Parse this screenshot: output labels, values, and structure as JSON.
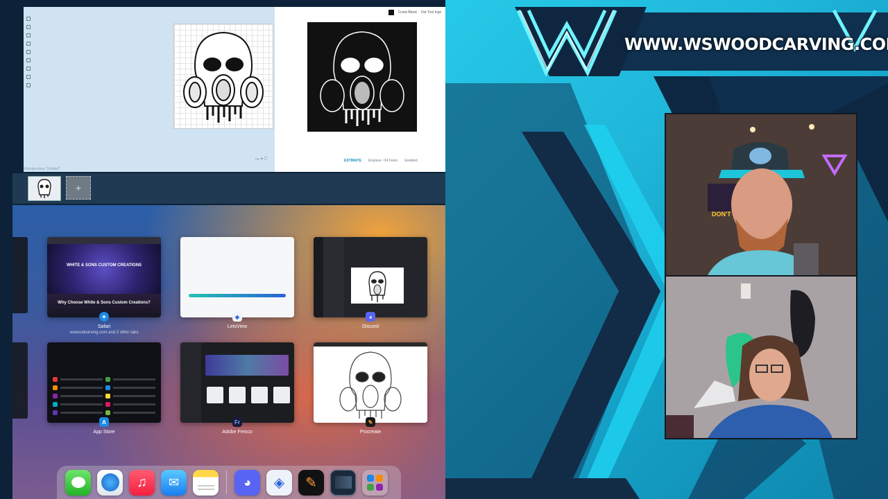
{
  "overlay": {
    "site_url": "WWW.WSWOODCARVING.COM",
    "sign_text": "DON'T TREA"
  },
  "top_app": {
    "window_title": "Woodpeckers  \"Untitled\"",
    "estimate_label": "ESTIMATE",
    "estimate_time": "Engrave ~24 hours",
    "status": "Enabled",
    "toolbar_labels": [
      "Crank Bkwd",
      "Out Tool Ings"
    ],
    "zoom_ctrl": "— + ⛶"
  },
  "switcher": {
    "apps": [
      {
        "name": "Safari",
        "subtitle": "wswoodcarving.com and 2 other tabs"
      },
      {
        "name": "LetsView"
      },
      {
        "name": "Discord"
      },
      {
        "name": "App Store"
      },
      {
        "name": "Adobe Fresco"
      },
      {
        "name": "Procreate"
      }
    ],
    "safari_page": {
      "hero_title": "WHITE & SONS CUSTOM CREATIONS",
      "why_heading": "Why Choose White & Sons Custom Creations?"
    }
  },
  "dock": {
    "apps": [
      "Messages",
      "Safari",
      "Music",
      "Mail",
      "Notes",
      "Discord",
      "LetsView",
      "Procreate",
      "Recent apps",
      "App Library"
    ]
  },
  "colors": {
    "overlay_cyan": "#27c9e8",
    "overlay_dark": "#0f86ad",
    "deco_navy": "#122b47",
    "switcher_blue": "#2c5fa8",
    "switcher_orange": "#f0a23c",
    "accent_blue": "#1a8ec8"
  }
}
